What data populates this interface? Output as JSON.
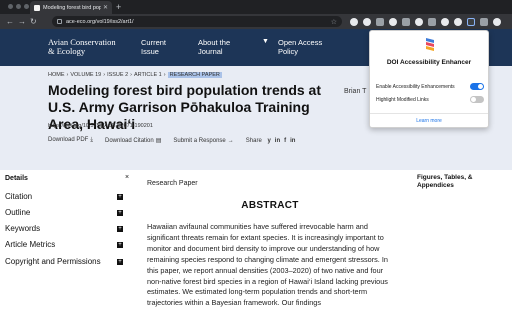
{
  "browser": {
    "tab_title": "Modeling forest bird populati",
    "url": "ace-eco.org/vol19/iss2/art1/"
  },
  "site": {
    "logo_line1": "Avian Conservation",
    "logo_line2": "& Ecology",
    "nav": [
      {
        "label_line1": "Current",
        "label_line2": "Issue"
      },
      {
        "label_line1": "About the",
        "label_line2": "Journal"
      },
      {
        "label_line1": "Open Access",
        "label_line2": "Policy"
      }
    ]
  },
  "article": {
    "breadcrumb": [
      "HOME",
      "›",
      "VOLUME 19",
      "›",
      "ISSUE 2",
      "›",
      "ARTICLE 1",
      "›"
    ],
    "breadcrumb_current": "RESEARCH PAPER",
    "title": "Modeling forest bird population trends at U.S. Army Garrison Pōhakuloa Training Area, Hawai‘i",
    "authors_partial": "Brian T",
    "doi": "https://doi.org/10.5751/ACE-02671-190201",
    "download_pdf": "Download PDF",
    "download_citation": "Download Citation",
    "submit_response": "Submit a Response",
    "share": "Share",
    "share_icons": [
      "y",
      "in",
      "f",
      "in"
    ]
  },
  "sidebar": {
    "header": "Details",
    "close": "×",
    "items": [
      "Citation",
      "Outline",
      "Keywords",
      "Article Metrics",
      "Copyright and Permissions"
    ],
    "expand_glyph": "+"
  },
  "main": {
    "paper_type": "Research Paper",
    "abstract_heading": "ABSTRACT",
    "abstract_text": "Hawaiian avifaunal communities have suffered irrevocable harm and significant threats remain for extant species. It is increasingly important to monitor and document bird density to improve our understanding of how remaining species respond to changing climate and emergent stressors. In this paper, we report annual densities (2003–2020) of two native and four non-native forest bird species in a region of Hawai‘i Island lacking previous estimates. We estimated long-term population trends and short-term trajectories within a Bayesian framework. Our findings"
  },
  "right_panel": {
    "label": "Figures, Tables, & Appendices"
  },
  "popup": {
    "title": "DOI Accessibility Enhancer",
    "option1_label": "Enable Accessibility Enhancements",
    "option1_on": true,
    "option2_label": "Highlight Modified Links",
    "option2_on": false,
    "link": "Learn more"
  },
  "colors": {
    "header_bg": "#1d3557",
    "hero_bg": "#e8ecf4",
    "toggle_on": "#1a73e8",
    "breadcrumb_highlight": "#aac2e8"
  }
}
